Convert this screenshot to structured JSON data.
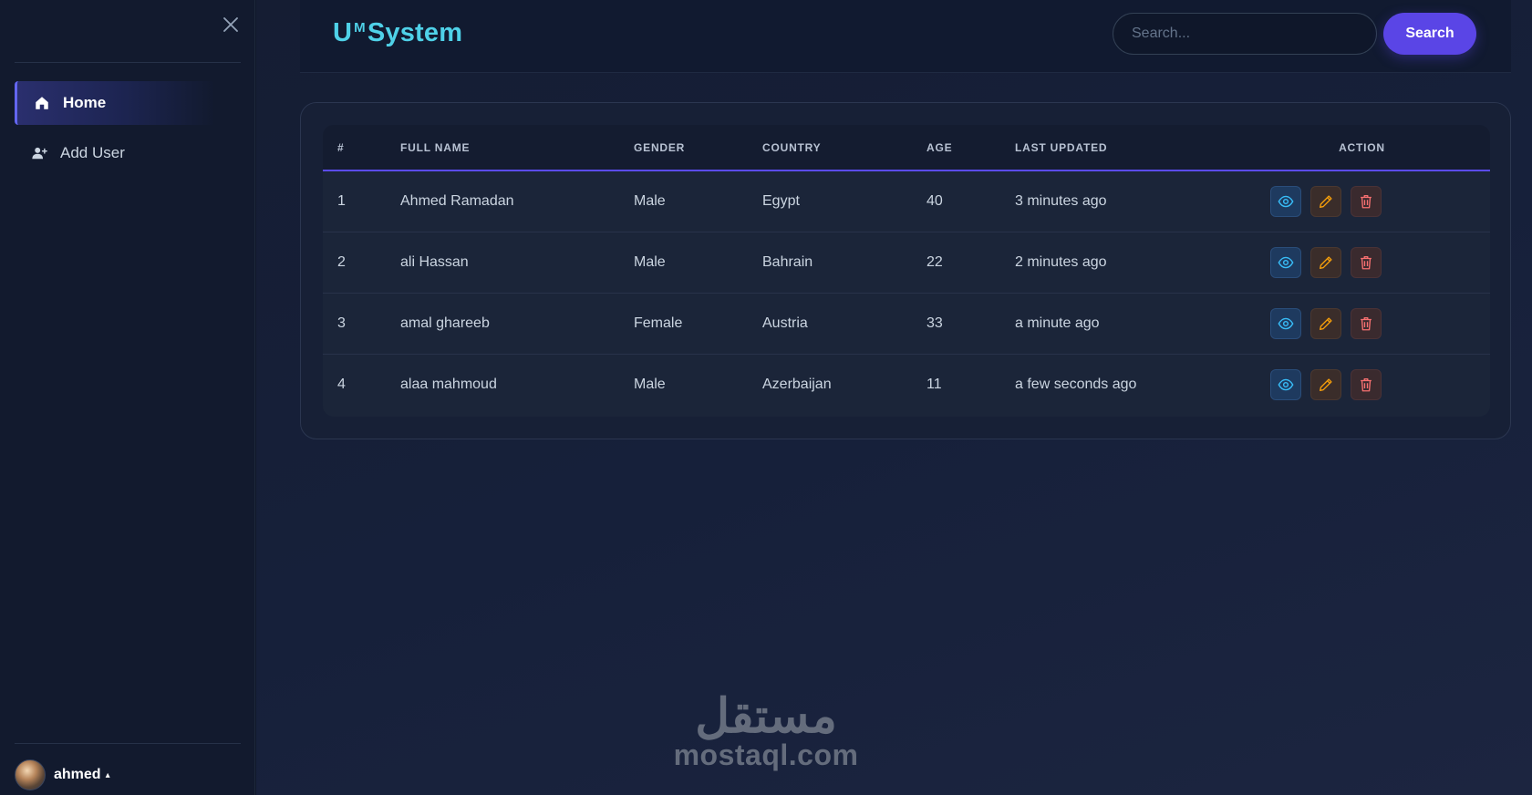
{
  "sidebar": {
    "items": [
      {
        "label": "Home",
        "icon": "home-icon",
        "active": true
      },
      {
        "label": "Add User",
        "icon": "add-user-icon",
        "active": false
      }
    ],
    "user": {
      "name": "ahmed",
      "caret": "▴"
    }
  },
  "header": {
    "brand_prefix": "U",
    "brand_sup": "M",
    "brand_suffix": "System",
    "search_placeholder": "Search...",
    "search_button": "Search"
  },
  "table": {
    "columns": [
      "#",
      "FULL NAME",
      "GENDER",
      "COUNTRY",
      "AGE",
      "LAST UPDATED",
      "ACTION"
    ],
    "rows": [
      {
        "id": "1",
        "name": "Ahmed Ramadan",
        "gender": "Male",
        "country": "Egypt",
        "age": "40",
        "updated": "3 minutes ago"
      },
      {
        "id": "2",
        "name": "ali Hassan",
        "gender": "Male",
        "country": "Bahrain",
        "age": "22",
        "updated": "2 minutes ago"
      },
      {
        "id": "3",
        "name": "amal ghareeb",
        "gender": "Female",
        "country": "Austria",
        "age": "33",
        "updated": "a minute ago"
      },
      {
        "id": "4",
        "name": "alaa mahmoud",
        "gender": "Male",
        "country": "Azerbaijan",
        "age": "11",
        "updated": "a few seconds ago"
      }
    ]
  },
  "watermark": {
    "arabic": "مستقل",
    "latin": "mostaql.com"
  },
  "colors": {
    "accent": "#5a45e6",
    "brand": "#4fd1e8",
    "view": "#38bdf8",
    "edit": "#f59e0b",
    "delete": "#f87171"
  }
}
